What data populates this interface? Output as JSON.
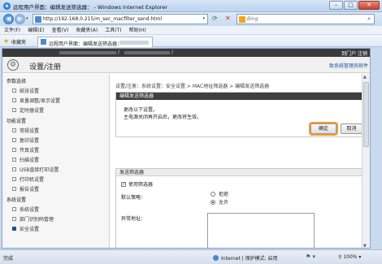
{
  "window": {
    "title": "远程用户界面：编辑发送筛选器：         - Windows Internet Explorer",
    "min": "–",
    "max": "□",
    "close": "✕"
  },
  "address": {
    "url": "http://192.168.0.215/m_sec_macfilter_send.html",
    "search_placeholder": "Bing"
  },
  "menu": [
    "文件(F)",
    "编辑(E)",
    "查看(V)",
    "收藏夹(A)",
    "工具(T)",
    "帮助(H)"
  ],
  "favorites": {
    "label": "收藏夹",
    "tab_title": "远程用户界面：编辑发送筛选器："
  },
  "topbar": {
    "links": "到门户  注销"
  },
  "page": {
    "title": "设置/注册",
    "header_link": "致系统管理员邮件"
  },
  "sidebar": {
    "groups": [
      {
        "label": "参数选择",
        "items": [
          "纸张设置",
          "显量调整/显示设置",
          "定时器设置"
        ]
      },
      {
        "label": "功能设置",
        "items": [
          "常规设置",
          "复印设置",
          "传真设置",
          "扫描设置",
          "USB直接打印设置",
          "打印机设置",
          "报告设置"
        ]
      },
      {
        "label": "系统设置",
        "items": [
          "系统设置",
          "部门识别码管理",
          "安全设置"
        ]
      }
    ],
    "active_item": "安全设置"
  },
  "breadcrumb": "设置/注册：系统设置：安全设置 > MAC地址筛选器 > 编辑发送筛选器",
  "edit_panel": {
    "title": "编辑发送筛选器",
    "message_line1": "更改以下设置。",
    "message_line2": "主电源关闭再开启后，更改将生效。",
    "ok_label": "确定",
    "cancel_label": "取消"
  },
  "filter_panel": {
    "title": "发送筛选器",
    "use_filter_label": "使用筛选器",
    "use_filter_checked": true,
    "policy_label": "默认策略：",
    "options": [
      "拒绝",
      "允许"
    ],
    "selected_option": "允许",
    "exceptions_label": "异常地址："
  },
  "statusbar": {
    "done": "完成",
    "zone": "Internet | 保护模式: 启用",
    "zoom": "100%"
  }
}
